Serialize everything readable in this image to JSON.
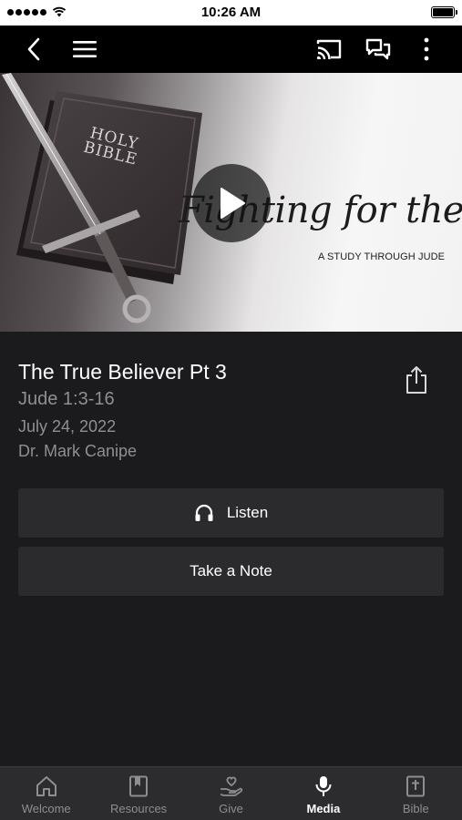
{
  "status_bar": {
    "time": "10:26 AM"
  },
  "nav": {
    "back_icon": "chevron-left-icon",
    "menu_icon": "hamburger-menu-icon",
    "cast_icon": "cast-icon",
    "chat_icon": "chat-bubbles-icon",
    "more_icon": "more-vertical-icon"
  },
  "hero": {
    "bible_text_line1": "HOLY",
    "bible_text_line2": "BIBLE",
    "series_title": "Fighting for the Faith",
    "series_subtitle": "A STUDY THROUGH JUDE"
  },
  "sermon": {
    "title": "The True Believer Pt 3",
    "scripture": "Jude 1:3-16",
    "date": "July 24, 2022",
    "speaker": "Dr. Mark Canipe"
  },
  "actions": {
    "listen_label": "Listen",
    "note_label": "Take a Note"
  },
  "tabs": [
    {
      "label": "Welcome",
      "icon": "house-icon",
      "active": false
    },
    {
      "label": "Resources",
      "icon": "book-icon",
      "active": false
    },
    {
      "label": "Give",
      "icon": "hand-heart-icon",
      "active": false
    },
    {
      "label": "Media",
      "icon": "microphone-icon",
      "active": true
    },
    {
      "label": "Bible",
      "icon": "bible-icon",
      "active": false
    }
  ],
  "colors": {
    "background": "#1b1b1d",
    "button": "#2b2b2d",
    "muted_text": "#8f8f93",
    "tab_bar": "#2c2c2e"
  }
}
